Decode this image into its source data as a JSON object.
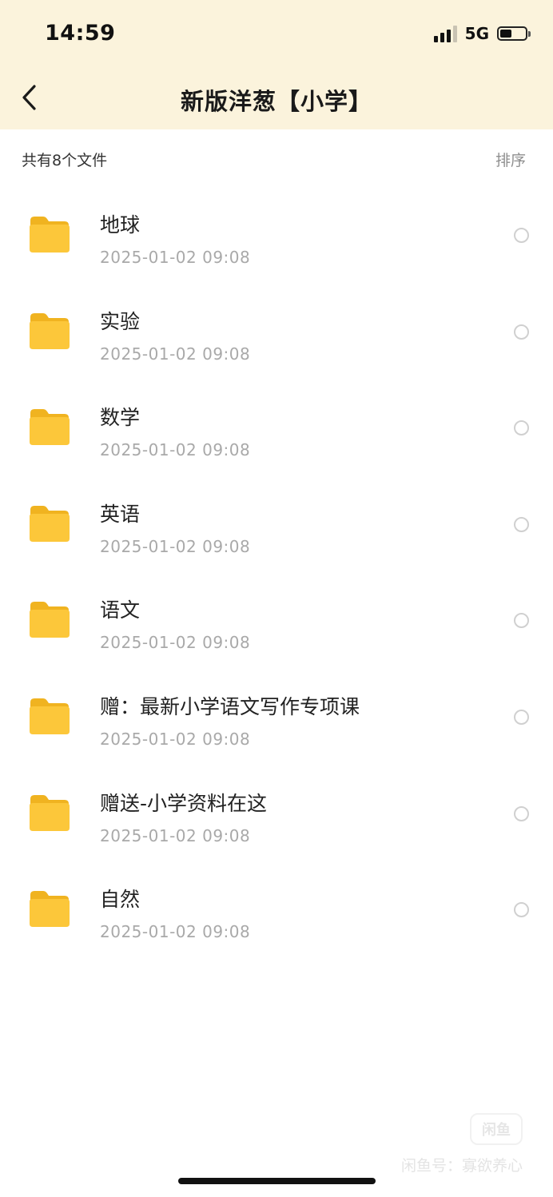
{
  "status_bar": {
    "time": "14:59",
    "network": "5G",
    "signal_icon": "signal-bars-icon",
    "battery_icon": "battery-icon"
  },
  "header": {
    "title": "新版洋葱【小学】",
    "back_icon": "chevron-left-icon",
    "background_color": "#fbf3dc"
  },
  "summary": {
    "file_count_text": "共有8个文件",
    "sort_label": "排序"
  },
  "files": [
    {
      "name": "地球",
      "date": "2025-01-02 09:08",
      "icon": "folder-icon"
    },
    {
      "name": "实验",
      "date": "2025-01-02 09:08",
      "icon": "folder-icon"
    },
    {
      "name": "数学",
      "date": "2025-01-02 09:08",
      "icon": "folder-icon"
    },
    {
      "name": "英语",
      "date": "2025-01-02 09:08",
      "icon": "folder-icon"
    },
    {
      "name": "语文",
      "date": "2025-01-02 09:08",
      "icon": "folder-icon"
    },
    {
      "name": "赠：最新小学语文写作专项课",
      "date": "2025-01-02 09:08",
      "icon": "folder-icon"
    },
    {
      "name": "赠送-小学资料在这",
      "date": "2025-01-02 09:08",
      "icon": "folder-icon"
    },
    {
      "name": "自然",
      "date": "2025-01-02 09:08",
      "icon": "folder-icon"
    }
  ],
  "watermark": {
    "badge": "闲鱼",
    "text": "闲鱼号：寡欲养心"
  },
  "colors": {
    "folder": "#fcc73a",
    "date_text": "#a9a9a9",
    "radio_border": "#d0d0d0"
  }
}
